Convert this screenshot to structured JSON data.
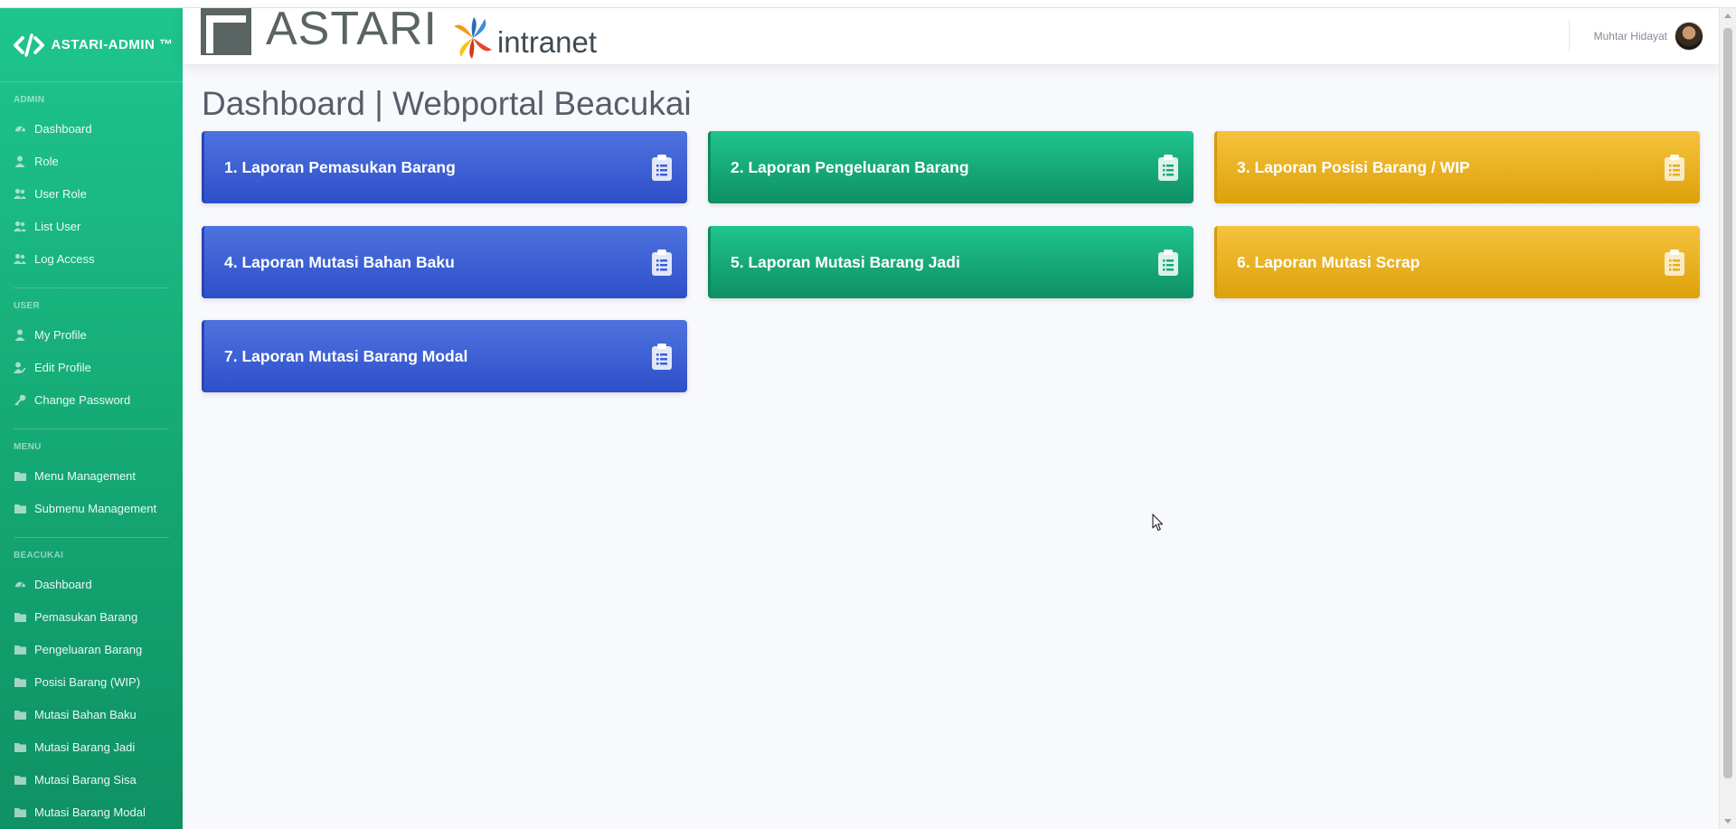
{
  "sidebar": {
    "brand": "ASTARI-ADMIN ™",
    "sections": [
      {
        "heading": "ADMIN",
        "items": [
          {
            "label": "Dashboard",
            "icon": "tachometer-icon"
          },
          {
            "label": "Role",
            "icon": "user-icon"
          },
          {
            "label": "User Role",
            "icon": "user-group-icon"
          },
          {
            "label": "List User",
            "icon": "user-group-icon"
          },
          {
            "label": "Log Access",
            "icon": "user-group-icon"
          }
        ]
      },
      {
        "heading": "USER",
        "items": [
          {
            "label": "My Profile",
            "icon": "user-icon"
          },
          {
            "label": "Edit Profile",
            "icon": "user-edit-icon"
          },
          {
            "label": "Change Password",
            "icon": "key-icon"
          }
        ]
      },
      {
        "heading": "MENU",
        "items": [
          {
            "label": "Menu Management",
            "icon": "folder-icon"
          },
          {
            "label": "Submenu Management",
            "icon": "folder-icon"
          }
        ]
      },
      {
        "heading": "BEACUKAI",
        "items": [
          {
            "label": "Dashboard",
            "icon": "tachometer-icon"
          },
          {
            "label": "Pemasukan Barang",
            "icon": "folder-icon"
          },
          {
            "label": "Pengeluaran Barang",
            "icon": "folder-icon"
          },
          {
            "label": "Posisi Barang (WIP)",
            "icon": "folder-icon"
          },
          {
            "label": "Mutasi Bahan Baku",
            "icon": "folder-icon"
          },
          {
            "label": "Mutasi Barang Jadi",
            "icon": "folder-icon"
          },
          {
            "label": "Mutasi Barang Sisa",
            "icon": "folder-icon"
          },
          {
            "label": "Mutasi Barang Modal",
            "icon": "folder-icon"
          }
        ]
      }
    ]
  },
  "topbar": {
    "logo_word": "ASTARI",
    "logo_sub": "intranet",
    "user_name": "Muhtar Hidayat"
  },
  "page": {
    "title": "Dashboard | Webportal Beacukai"
  },
  "cards": [
    {
      "label": "1. Laporan Pemasukan Barang",
      "color": "blue",
      "icon": "clipboard-list-icon"
    },
    {
      "label": "2. Laporan Pengeluaran Barang",
      "color": "green",
      "icon": "clipboard-list-icon"
    },
    {
      "label": "3. Laporan Posisi Barang / WIP",
      "color": "yellow",
      "icon": "clipboard-list-icon"
    },
    {
      "label": "4. Laporan Mutasi Bahan Baku",
      "color": "blue",
      "icon": "clipboard-list-icon"
    },
    {
      "label": "5. Laporan Mutasi Barang Jadi",
      "color": "green",
      "icon": "clipboard-list-icon"
    },
    {
      "label": "6. Laporan Mutasi Scrap",
      "color": "yellow",
      "icon": "clipboard-list-icon"
    },
    {
      "label": "7. Laporan Mutasi Barang Modal",
      "color": "blue",
      "icon": "clipboard-list-icon"
    }
  ],
  "colors": {
    "sidebar_green": "#1cc88a",
    "card_blue": "#4e73df",
    "card_green": "#1cc88a",
    "card_yellow": "#f6c23e"
  }
}
